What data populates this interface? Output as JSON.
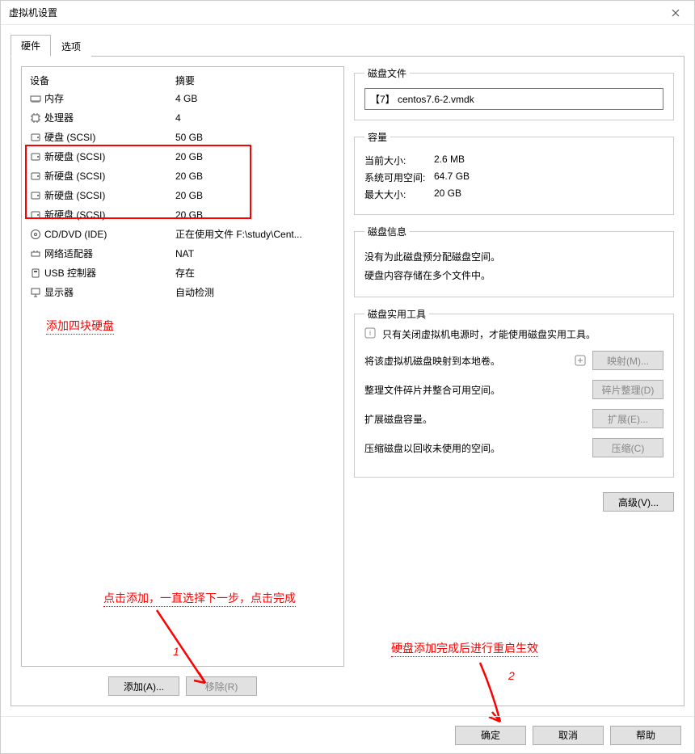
{
  "window": {
    "title": "虚拟机设置"
  },
  "tabs": {
    "hardware": "硬件",
    "options": "选项"
  },
  "list": {
    "header_device": "设备",
    "header_summary": "摘要",
    "rows": [
      {
        "icon": "memory",
        "name": "内存",
        "summary": "4 GB"
      },
      {
        "icon": "cpu",
        "name": "处理器",
        "summary": "4"
      },
      {
        "icon": "disk",
        "name": "硬盘 (SCSI)",
        "summary": "50 GB"
      },
      {
        "icon": "disk",
        "name": "新硬盘 (SCSI)",
        "summary": "20 GB"
      },
      {
        "icon": "disk",
        "name": "新硬盘 (SCSI)",
        "summary": "20 GB"
      },
      {
        "icon": "disk",
        "name": "新硬盘 (SCSI)",
        "summary": "20 GB"
      },
      {
        "icon": "disk",
        "name": "新硬盘 (SCSI)",
        "summary": "20 GB"
      },
      {
        "icon": "cd",
        "name": "CD/DVD (IDE)",
        "summary": "正在使用文件 F:\\study\\Cent..."
      },
      {
        "icon": "net",
        "name": "网络适配器",
        "summary": "NAT"
      },
      {
        "icon": "usb",
        "name": "USB 控制器",
        "summary": "存在"
      },
      {
        "icon": "display",
        "name": "显示器",
        "summary": "自动检测"
      }
    ],
    "add_button": "添加(A)...",
    "remove_button": "移除(R)"
  },
  "right": {
    "disk_file_legend": "磁盘文件",
    "disk_file": "【7】 centos7.6-2.vmdk",
    "capacity_legend": "容量",
    "cap_current_label": "当前大小:",
    "cap_current_value": "2.6 MB",
    "cap_free_label": "系统可用空间:",
    "cap_free_value": "64.7 GB",
    "cap_max_label": "最大大小:",
    "cap_max_value": "20 GB",
    "info_legend": "磁盘信息",
    "info_line1": "没有为此磁盘预分配磁盘空间。",
    "info_line2": "硬盘内容存储在多个文件中。",
    "util_legend": "磁盘实用工具",
    "util_warn": "只有关闭虚拟机电源时，才能使用磁盘实用工具。",
    "map_text": "将该虚拟机磁盘映射到本地卷。",
    "map_btn": "映射(M)...",
    "defrag_text": "整理文件碎片并整合可用空间。",
    "defrag_btn": "碎片整理(D)",
    "expand_text": "扩展磁盘容量。",
    "expand_btn": "扩展(E)...",
    "compact_text": "压缩磁盘以回收未使用的空间。",
    "compact_btn": "压缩(C)",
    "advanced_btn": "高级(V)..."
  },
  "annotations": {
    "add_disks": "添加四块硬盘",
    "click_add": "点击添加，一直选择下一步，点击完成",
    "restart": "硬盘添加完成后进行重启生效",
    "one": "1",
    "two": "2"
  },
  "footer": {
    "ok": "确定",
    "cancel": "取消",
    "help": "帮助"
  }
}
